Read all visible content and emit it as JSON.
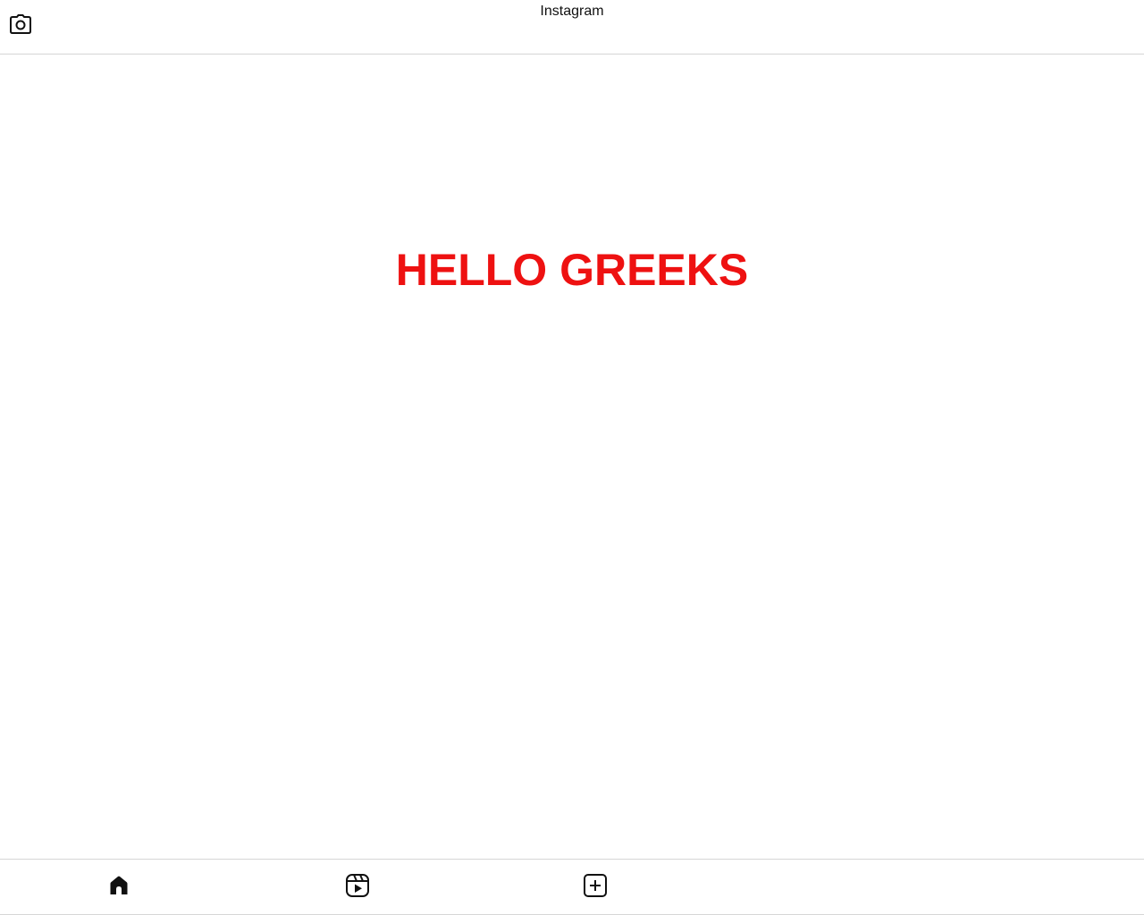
{
  "header": {
    "title": "Instagram",
    "left_icon": "camera-icon"
  },
  "main": {
    "headline": "HELLO GREEKS",
    "headline_color": "#ee1111"
  },
  "bottom_nav": {
    "items": [
      {
        "icon": "home-icon"
      },
      {
        "icon": "reels-icon"
      },
      {
        "icon": "add-post-icon"
      }
    ]
  }
}
